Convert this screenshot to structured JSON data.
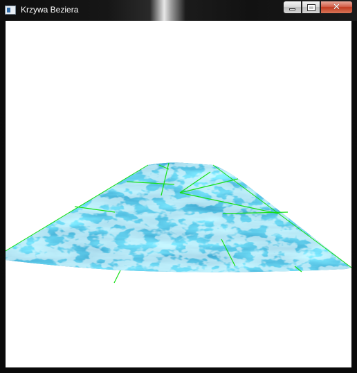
{
  "window": {
    "title": "Krzywa Beziera",
    "icon": "app-window-icon",
    "controls": {
      "minimize_icon": "minimize-icon",
      "maximize_icon": "maximize-icon",
      "close_icon": "close-icon"
    }
  },
  "viewport": {
    "background": "#ffffff",
    "surface_texture": "water",
    "surface_color": "#3a8fb5",
    "normal_line_color": "#16e016"
  }
}
